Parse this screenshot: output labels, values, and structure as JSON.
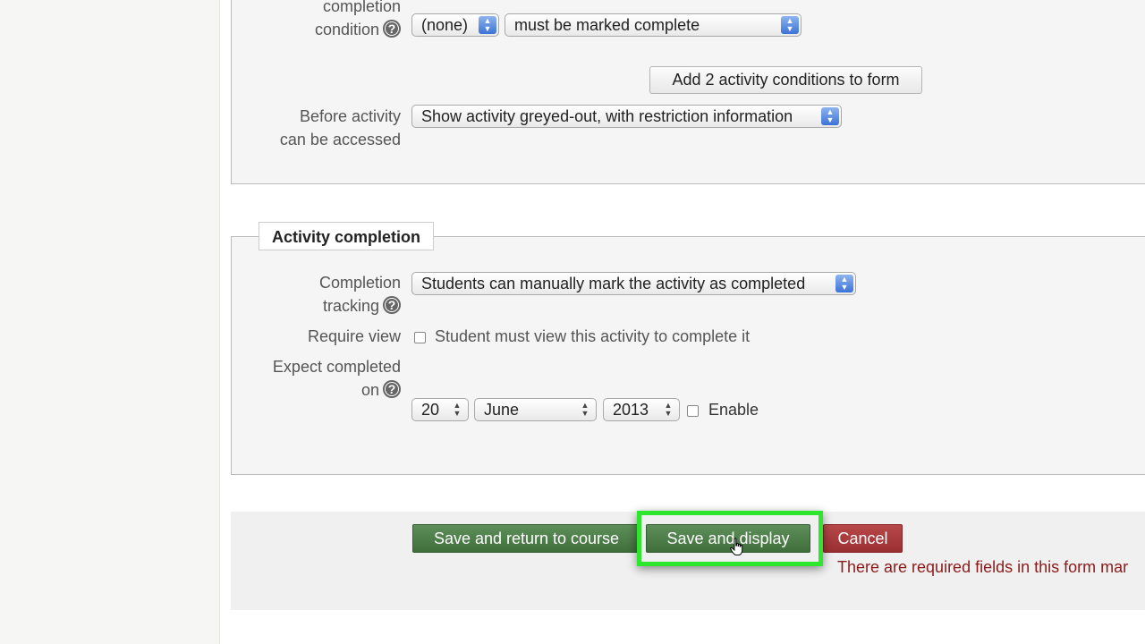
{
  "restrict": {
    "condition_label_partial": "completion",
    "condition_label": "condition",
    "activity_select": "(none)",
    "condition_select": "must be marked complete",
    "add_conditions_button": "Add 2 activity conditions to form",
    "before_access_label_line1": "Before activity",
    "before_access_label_line2": "can be accessed",
    "before_access_select": "Show activity greyed-out, with restriction information"
  },
  "completion": {
    "legend": "Activity completion",
    "tracking_label_line1": "Completion",
    "tracking_label_line2": "tracking",
    "tracking_select": "Students can manually mark the activity as completed",
    "require_view_label": "Require view",
    "require_view_checkbox_label": "Student must view this activity to complete it",
    "expect_label_line1": "Expect completed",
    "expect_label_line2": "on",
    "day": "20",
    "month": "June",
    "year": "2013",
    "enable_label": "Enable"
  },
  "help_icon_glyph": "?",
  "arrow_glyphs": {
    "up": "▲",
    "down": "▼"
  },
  "buttons": {
    "save_return": "Save and return to course",
    "save_display": "Save and display",
    "cancel": "Cancel"
  },
  "error_message": "There are required fields in this form mar",
  "colors": {
    "primary_green": "#4a7c46",
    "danger_red": "#a83436",
    "highlight_green": "#2ee62e",
    "error_text": "#8b1a1a"
  }
}
